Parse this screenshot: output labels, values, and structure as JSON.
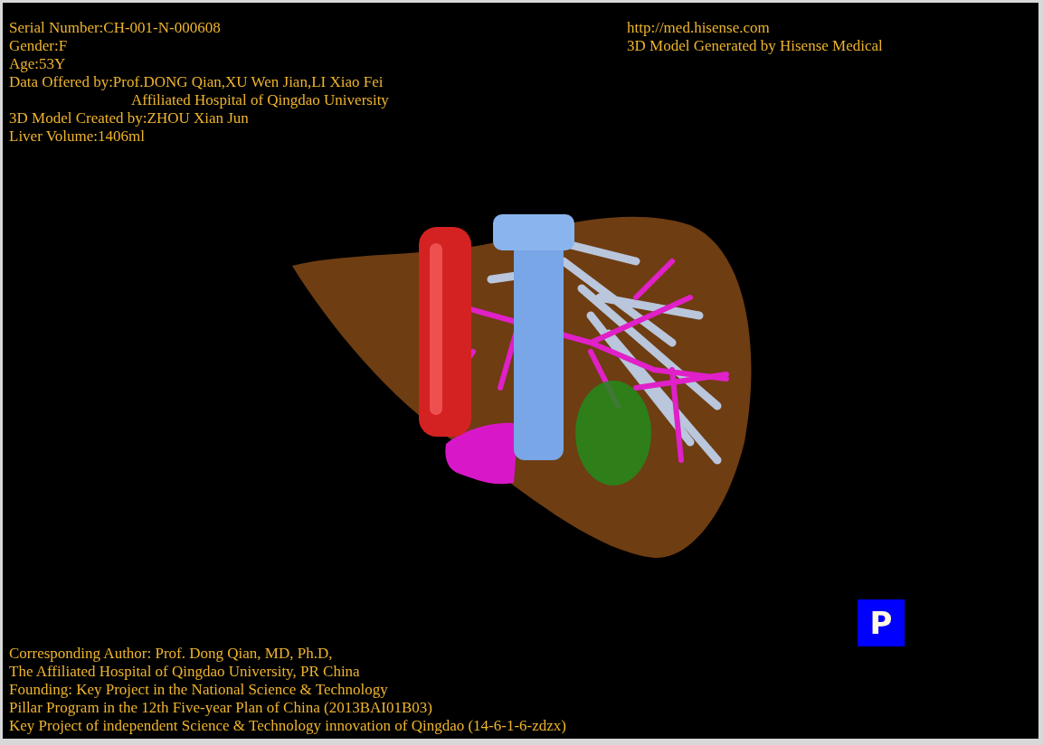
{
  "info_left": [
    {
      "kind": "line",
      "text": "Serial Number:CH-001-N-000608"
    },
    {
      "kind": "line",
      "text": "Gender:F"
    },
    {
      "kind": "line",
      "text": "Age:53Y"
    },
    {
      "kind": "line",
      "text": "Data Offered by:Prof.DONG Qian,XU Wen Jian,LI Xiao Fei"
    },
    {
      "kind": "continuation",
      "text": "Affiliated Hospital of Qingdao University"
    },
    {
      "kind": "line",
      "text": "3D Model Created by:ZHOU Xian Jun"
    },
    {
      "kind": "line",
      "text": "Liver Volume:1406ml"
    }
  ],
  "info_right": [
    "http://med.hisense.com",
    "3D Model Generated by Hisense Medical"
  ],
  "mode_button": {
    "label": "P"
  },
  "credits": [
    "Corresponding Author: Prof. Dong Qian, MD, Ph.D,",
    "The Affiliated Hospital of Qingdao University, PR China",
    "Founding: Key Project in the National Science & Technology",
    "Pillar Program in the 12th Five-year Plan of China (2013BAI01B03)",
    "Key Project of independent Science & Technology innovation of Qingdao (14-6-1-6-zdzx)"
  ]
}
